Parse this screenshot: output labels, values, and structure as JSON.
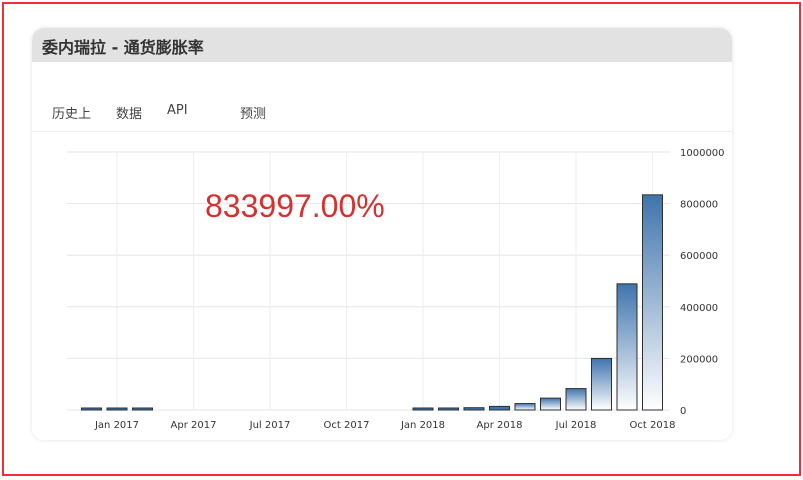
{
  "card": {
    "title": "委内瑞拉 - 通货膨胀率"
  },
  "tabs": [
    {
      "label": "历史上"
    },
    {
      "label": "数据"
    },
    {
      "label": "API"
    },
    {
      "label": "预测"
    }
  ],
  "highlight_value": "833997.00%",
  "colors": {
    "frame_border": "#e8313a",
    "highlight": "#d63030",
    "bar_dark": "#3f74ad",
    "bar_light": "#ffffff"
  },
  "chart_data": {
    "type": "bar",
    "x_tick_labels": [
      "Jan 2017",
      "Apr 2017",
      "Jul 2017",
      "Oct 2017",
      "Jan 2018",
      "Apr 2018",
      "Jul 2018",
      "Oct 2018"
    ],
    "y_tick_labels": [
      "0",
      "200000",
      "400000",
      "600000",
      "800000",
      "1000000"
    ],
    "ylim": [
      0,
      1000000
    ],
    "y_axis_position": "right",
    "grid": true,
    "bars": [
      {
        "month": "2016-12",
        "value": 1500
      },
      {
        "month": "2017-01",
        "value": 0
      },
      {
        "month": "2017-02",
        "value": 1500
      },
      {
        "month": "2018-01",
        "value": 2600
      },
      {
        "month": "2018-02",
        "value": 4000
      },
      {
        "month": "2018-03",
        "value": 8900
      },
      {
        "month": "2018-04",
        "value": 14000
      },
      {
        "month": "2018-05",
        "value": 25000
      },
      {
        "month": "2018-06",
        "value": 46000
      },
      {
        "month": "2018-07",
        "value": 83000
      },
      {
        "month": "2018-08",
        "value": 200000
      },
      {
        "month": "2018-09",
        "value": 489000
      },
      {
        "month": "2018-10",
        "value": 834000
      }
    ]
  }
}
